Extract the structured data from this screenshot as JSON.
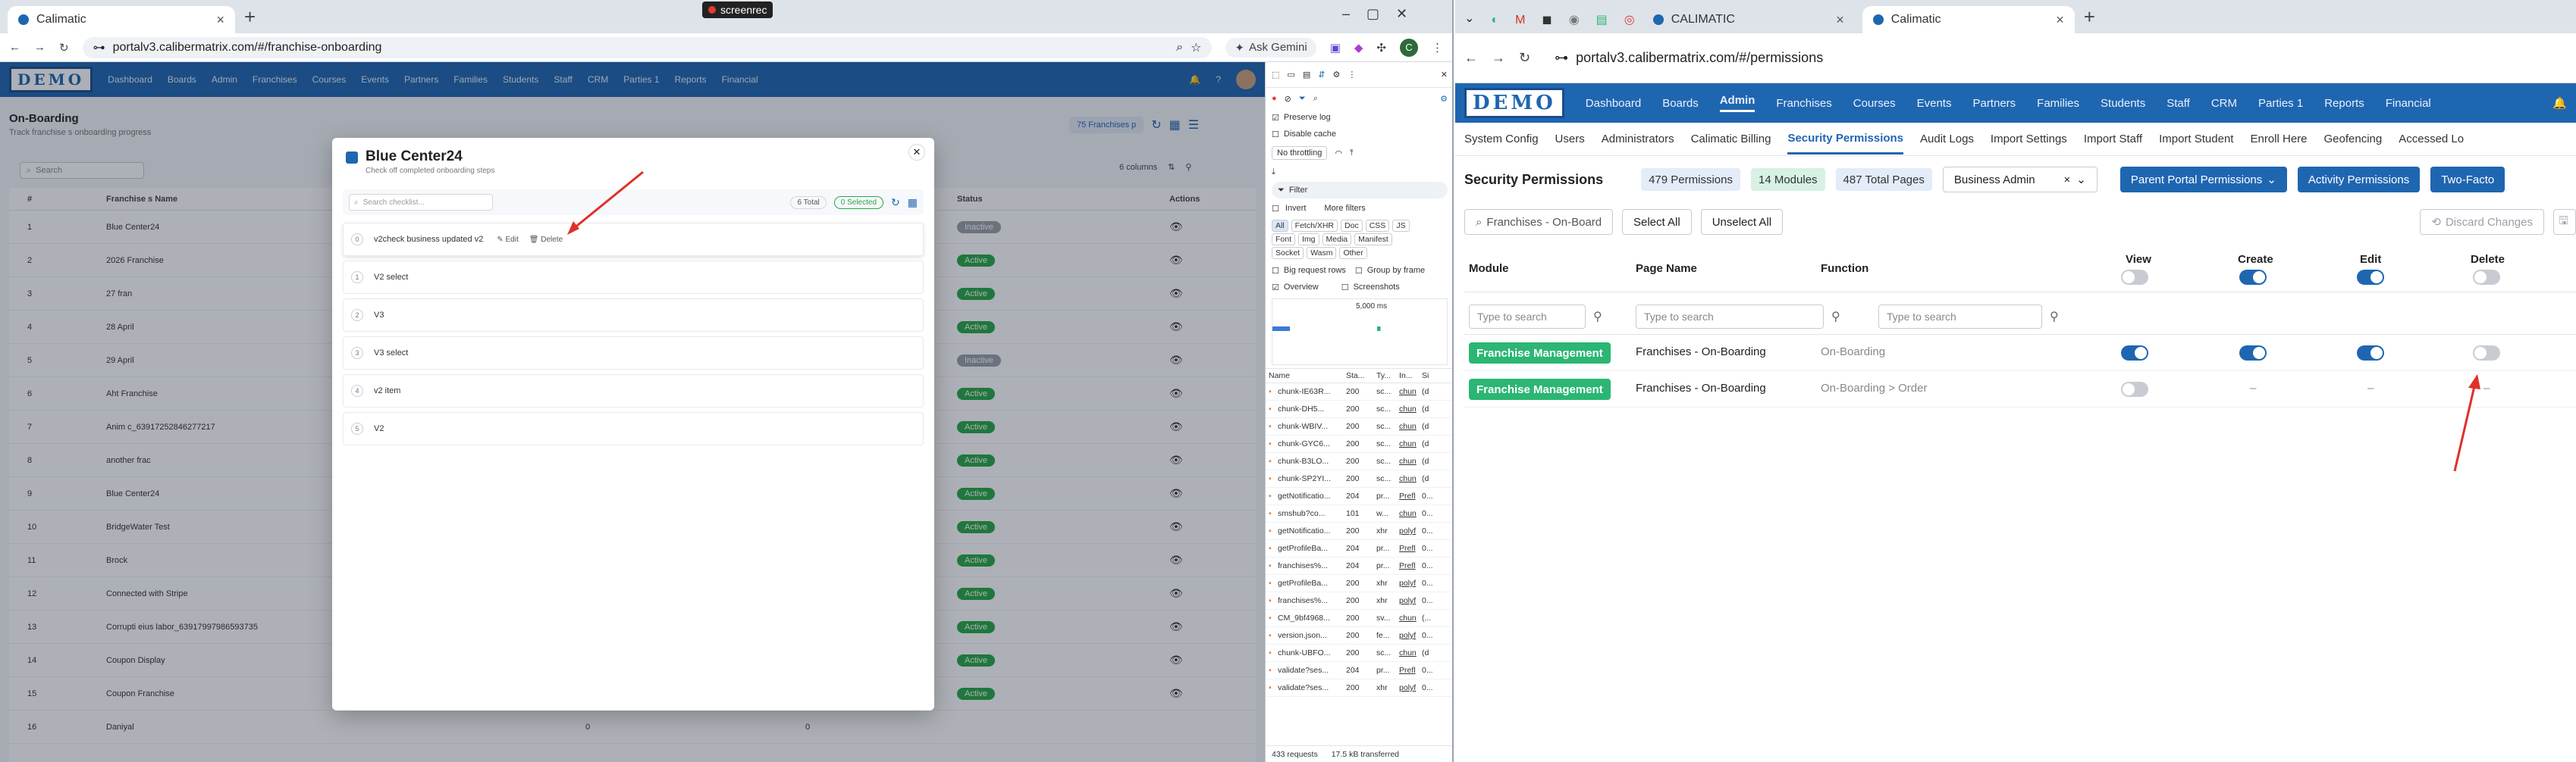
{
  "left_browser": {
    "tab_title": "Calimatic",
    "url": "portalv3.calibermatrix.com/#/franchise-onboarding",
    "screenrec": "screenrec",
    "ask_gemini": "Ask Gemini"
  },
  "left_app": {
    "logo": "DEMO",
    "nav": [
      "Dashboard",
      "Boards",
      "Admin",
      "Franchises",
      "Courses",
      "Events",
      "Partners",
      "Families",
      "Students",
      "Staff",
      "CRM",
      "Parties 1",
      "Reports",
      "Financial"
    ],
    "page_title": "On-Boarding",
    "page_subtitle": "Track franchise s onboarding progress",
    "franchises_badge": "75 Franchises p",
    "search_placeholder": "Search",
    "columns_label": "6 columns",
    "headers": {
      "num": "#",
      "name": "Franchise s Name",
      "status": "Status",
      "actions": "Actions"
    },
    "rows": [
      {
        "num": "1",
        "name": "Blue Center24",
        "status": "Inactive"
      },
      {
        "num": "2",
        "name": "2026 Franchise",
        "status": "Active"
      },
      {
        "num": "3",
        "name": "27 fran",
        "status": "Active"
      },
      {
        "num": "4",
        "name": "28 April",
        "status": "Active"
      },
      {
        "num": "5",
        "name": "29 April",
        "status": "Inactive"
      },
      {
        "num": "6",
        "name": "Aht Franchise",
        "status": "Active"
      },
      {
        "num": "7",
        "name": "Anim c_63917252846277217",
        "status": "Active"
      },
      {
        "num": "8",
        "name": "another frac",
        "status": "Active"
      },
      {
        "num": "9",
        "name": "Blue Center24",
        "status": "Active"
      },
      {
        "num": "10",
        "name": "BridgeWater Test",
        "status": "Active"
      },
      {
        "num": "11",
        "name": "Brock",
        "status": "Active"
      },
      {
        "num": "12",
        "name": "Connected with Stripe",
        "status": "Active"
      },
      {
        "num": "13",
        "name": "Corrupti eius labor_63917997986593735",
        "status": "Active"
      },
      {
        "num": "14",
        "name": "Coupon Display",
        "status": "Active"
      },
      {
        "num": "15",
        "name": "Coupon Franchise",
        "status": "Active"
      },
      {
        "num": "16",
        "name": "Daniyal",
        "status": "",
        "c1": "0",
        "c2": "0"
      }
    ]
  },
  "modal": {
    "title": "Blue Center24",
    "subtitle": "Check off completed onboarding steps",
    "search_placeholder": "Search checklist...",
    "total": "6 Total",
    "selected": "0 Selected",
    "edit": "Edit",
    "delete": "Delete",
    "items": [
      {
        "idx": "0",
        "label": "v2check business updated v2"
      },
      {
        "idx": "1",
        "label": "V2 select"
      },
      {
        "idx": "2",
        "label": "V3"
      },
      {
        "idx": "3",
        "label": "V3 select"
      },
      {
        "idx": "4",
        "label": "v2 item"
      },
      {
        "idx": "5",
        "label": "V2"
      }
    ]
  },
  "devtools": {
    "preserve_log": "Preserve log",
    "disable_cache": "Disable cache",
    "throttling": "No throttling",
    "filter": "Filter",
    "invert": "Invert",
    "more_filters": "More filters",
    "types_row1": [
      "All",
      "Fetch/XHR",
      "Doc",
      "CSS",
      "JS"
    ],
    "types_row2": [
      "Font",
      "Img",
      "Media",
      "Manifest"
    ],
    "types_row3": [
      "Socket",
      "Wasm",
      "Other"
    ],
    "big_rows": "Big request rows",
    "group_frame": "Group by frame",
    "overview": "Overview",
    "screenshots": "Screenshots",
    "timeline_label": "5,000 ms",
    "cols": [
      "Name",
      "Sta...",
      "Ty...",
      "In...",
      "Si"
    ],
    "rows": [
      {
        "n": "chunk-IE63R...",
        "s": "200",
        "t": "sc...",
        "i": "chun",
        "z": "(d"
      },
      {
        "n": "chunk-DH5...",
        "s": "200",
        "t": "sc...",
        "i": "chun",
        "z": "(d"
      },
      {
        "n": "chunk-WBIV...",
        "s": "200",
        "t": "sc...",
        "i": "chun",
        "z": "(d"
      },
      {
        "n": "chunk-GYC6...",
        "s": "200",
        "t": "sc...",
        "i": "chun",
        "z": "(d"
      },
      {
        "n": "chunk-B3LO...",
        "s": "200",
        "t": "sc...",
        "i": "chun",
        "z": "(d"
      },
      {
        "n": "chunk-SP2YI...",
        "s": "200",
        "t": "sc...",
        "i": "chun",
        "z": "(d"
      },
      {
        "n": "getNotificatio...",
        "s": "204",
        "t": "pr...",
        "i": "Prefl",
        "z": "0..."
      },
      {
        "n": "smshub?co...",
        "s": "101",
        "t": "w...",
        "i": "chun",
        "z": "0..."
      },
      {
        "n": "getNotificatio...",
        "s": "200",
        "t": "xhr",
        "i": "polyf",
        "z": "0..."
      },
      {
        "n": "getProfileBa...",
        "s": "204",
        "t": "pr...",
        "i": "Prefl",
        "z": "0..."
      },
      {
        "n": "franchises%...",
        "s": "204",
        "t": "pr...",
        "i": "Prefl",
        "z": "0..."
      },
      {
        "n": "getProfileBa...",
        "s": "200",
        "t": "xhr",
        "i": "polyf",
        "z": "0..."
      },
      {
        "n": "franchises%...",
        "s": "200",
        "t": "xhr",
        "i": "polyf",
        "z": "0..."
      },
      {
        "n": "CM_9bf4968...",
        "s": "200",
        "t": "sv...",
        "i": "chun",
        "z": "(..."
      },
      {
        "n": "version.json...",
        "s": "200",
        "t": "fe...",
        "i": "polyf",
        "z": "0..."
      },
      {
        "n": "chunk-UBFO...",
        "s": "200",
        "t": "sc...",
        "i": "chun",
        "z": "(d"
      },
      {
        "n": "validate?ses...",
        "s": "204",
        "t": "pr...",
        "i": "Prefl",
        "z": "0..."
      },
      {
        "n": "validate?ses...",
        "s": "200",
        "t": "xhr",
        "i": "polyf",
        "z": "0..."
      }
    ],
    "footer_requests": "433 requests",
    "footer_transferred": "17.5 kB transferred"
  },
  "right_browser": {
    "tab1": "CALIMATIC",
    "tab2": "Calimatic",
    "url": "portalv3.calibermatrix.com/#/permissions"
  },
  "right_app": {
    "logo": "DEMO",
    "nav": [
      "Dashboard",
      "Boards",
      "Admin",
      "Franchises",
      "Courses",
      "Events",
      "Partners",
      "Families",
      "Students",
      "Staff",
      "CRM",
      "Parties 1",
      "Reports",
      "Financial"
    ],
    "subnav": [
      "System Config",
      "Users",
      "Administrators",
      "Calimatic Billing",
      "Security Permissions",
      "Audit Logs",
      "Import Settings",
      "Import Staff",
      "Import Student",
      "Enroll Here",
      "Geofencing",
      "Accessed Lo"
    ],
    "section_title": "Security Permissions",
    "permissions": "479 Permissions",
    "modules": "14 Modules",
    "pages": "487 Total Pages",
    "role": "Business Admin",
    "parent_portal": "Parent Portal Permissions",
    "activity": "Activity Permissions",
    "two_factor": "Two-Facto",
    "search_value": "Franchises - On-Board",
    "select_all": "Select All",
    "unselect_all": "Unselect All",
    "discard": "Discard Changes",
    "headers": {
      "module": "Module",
      "page": "Page Name",
      "function": "Function",
      "view": "View",
      "create": "Create",
      "edit": "Edit",
      "delete": "Delete"
    },
    "filter_placeholder": "Type to search",
    "rows": [
      {
        "module": "Franchise Management",
        "page": "Franchises - On-Boarding",
        "function": "On-Boarding",
        "view": true,
        "create": true,
        "edit": true,
        "delete": false
      },
      {
        "module": "Franchise Management",
        "page": "Franchises - On-Boarding",
        "function": "On-Boarding > Order",
        "view": false,
        "create": "–",
        "edit": "–",
        "delete": "–"
      }
    ]
  }
}
